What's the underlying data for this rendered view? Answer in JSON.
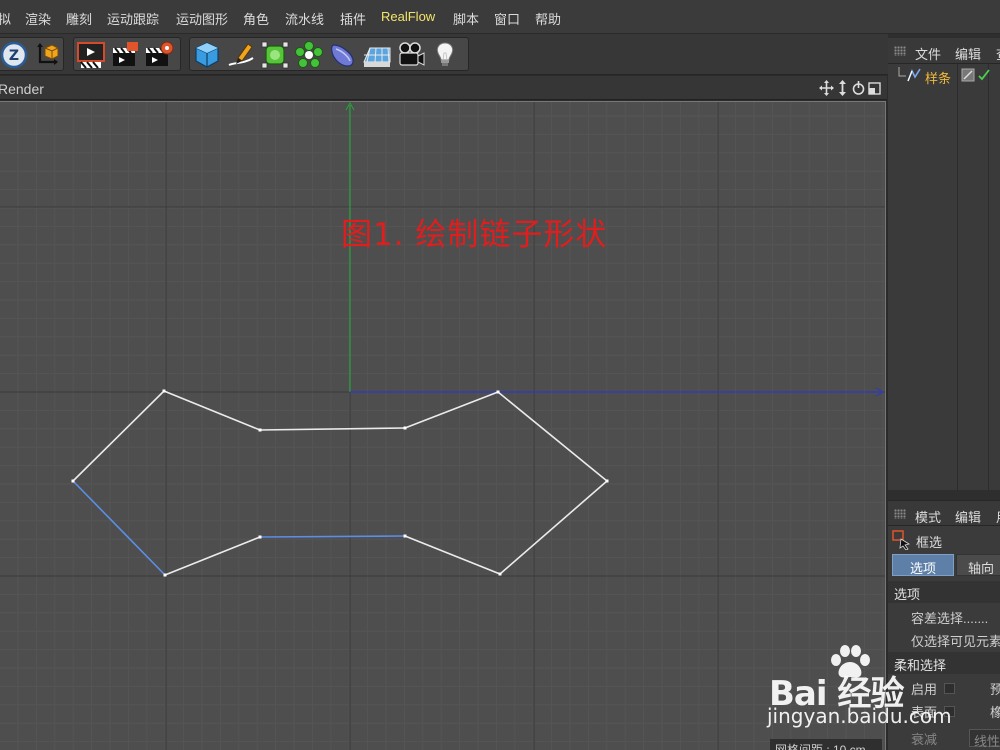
{
  "menu": {
    "items": [
      "拟",
      "渲染",
      "雕刻",
      "运动跟踪",
      "运动图形",
      "角色",
      "流水线",
      "插件",
      "RealFlow",
      "脚本",
      "窗口",
      "帮助"
    ],
    "highlighted": "RealFlow",
    "highlight_color": "#f2e56b"
  },
  "toolbar": {
    "icons": [
      "z-axis-lock-icon",
      "coordinate-system-icon",
      "render-view-icon",
      "render-picture-viewer-icon",
      "render-settings-icon",
      "cube-primitive-icon",
      "pen-spline-icon",
      "subdivision-surface-icon",
      "cloner-icon",
      "deformer-icon",
      "floor-scene-icon",
      "camera-icon",
      "light-icon"
    ]
  },
  "viewport": {
    "title": "Render",
    "annotation": "图1. 绘制链子形状",
    "annotation_color": "#e11d1d",
    "grid_spacing": "网格间距 : 10 cm",
    "background": "#4e4e4e",
    "x_axis_color": "#2d39c4",
    "y_axis_color": "#27a33a",
    "spline_color": "#ebebeb",
    "spline_selected_color": "#5b8ee6"
  },
  "object_manager": {
    "tabs": [
      "文件",
      "编辑",
      "查"
    ],
    "objects": [
      {
        "name": "样条",
        "name_color": "#f0b93a"
      }
    ]
  },
  "attribute_manager": {
    "tabs": [
      "模式",
      "编辑",
      "用"
    ],
    "tool_name": "框选",
    "tab_active": "选项",
    "tab_inactive": "轴向",
    "section_options": "选项",
    "tolerance_label": "容差选择.......",
    "visible_only_label": "仅选择可见元素",
    "section_soft": "柔和选择",
    "enable_label": "启用",
    "preview_label": "预",
    "surface_label": "表面",
    "rubber_label": "橡",
    "falloff_label": "衰减",
    "falloff_value": "线性"
  },
  "watermark": {
    "text": "Bai 经验",
    "url": "jingyan.baidu.com"
  }
}
